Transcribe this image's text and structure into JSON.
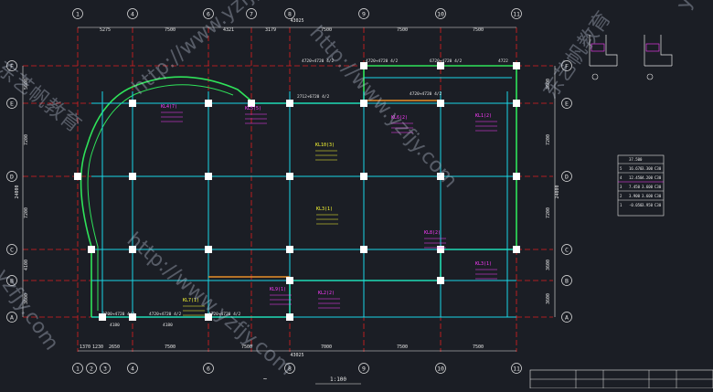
{
  "drawing": {
    "scale_label": "1:100",
    "view_symbol": "~",
    "grid_cols_top": [
      "1",
      "4",
      "6",
      "7",
      "8",
      "9",
      "10",
      "11"
    ],
    "grid_cols_bottom": [
      "1",
      "2",
      "3",
      "4",
      "6",
      "8",
      "9",
      "10",
      "11"
    ],
    "grid_rows_left": [
      "F",
      "E",
      "D",
      "C",
      "B",
      "A"
    ],
    "grid_rows_right": [
      "F",
      "E",
      "D",
      "C",
      "B",
      "A"
    ],
    "dims_top": [
      "5275",
      "7500",
      "4321",
      "3179",
      "7500",
      "7500",
      "7500"
    ],
    "dim_total_top": "43025",
    "dims_bottom": [
      "1370",
      "1230",
      "2650",
      "7500",
      "7500",
      "7000",
      "7500",
      "7500"
    ],
    "dim_total_bottom": "43025",
    "dims_left": [
      "5600",
      "7200",
      "7200",
      "4100",
      "3600"
    ],
    "dim_total_left": "24000",
    "dims_right": [
      "3600",
      "7200",
      "7200",
      "3600",
      "3600"
    ],
    "dim_total_right": "24000",
    "beam_notes": [
      "KL4(7)",
      "KL5(5)",
      "KL10(3)",
      "KL6(2)",
      "KL1(2)",
      "KL3(1)",
      "KL8(2)",
      "KL2(2)",
      "KL7(1)",
      "KL9(1)",
      "KL3(1)",
      "2700+4720 4/2",
      "4720+4720 4/2",
      "4720+4720 4/2",
      "2712+6720 4/2",
      "6720+4720 4/2",
      "4720+4720 4/2",
      "4720+4720 4/2",
      "4720+4720 4/2",
      "4722",
      "4180",
      "4180"
    ],
    "schedule": {
      "header": [
        "",
        "37.500",
        "",
        ""
      ],
      "rows": [
        [
          "5",
          "16.670",
          "3.300",
          "C30"
        ],
        [
          "4",
          "12.450",
          "4.200",
          "C30"
        ],
        [
          "3",
          "7.450",
          "3.600",
          "C30"
        ],
        [
          "2",
          "3.900",
          "3.600",
          "C30"
        ],
        [
          "1",
          "-0.050",
          "3.950",
          "C30"
        ]
      ]
    },
    "watermarks": [
      "http://www.yzfjy.com",
      "东艺帆教育",
      "yzfjy.com",
      "http://www.yzfjy.com",
      "东艺帆教育",
      "http://www.yzfjy.com",
      "yzfjy.com"
    ],
    "colors": {
      "grid": "#e02020",
      "beam": "#19d7e6",
      "outline": "#2fe35a",
      "column": "#ffffff",
      "text_magenta": "#ff3cff",
      "text_yellow": "#ffff33",
      "dim": "#e6e6e6"
    }
  }
}
